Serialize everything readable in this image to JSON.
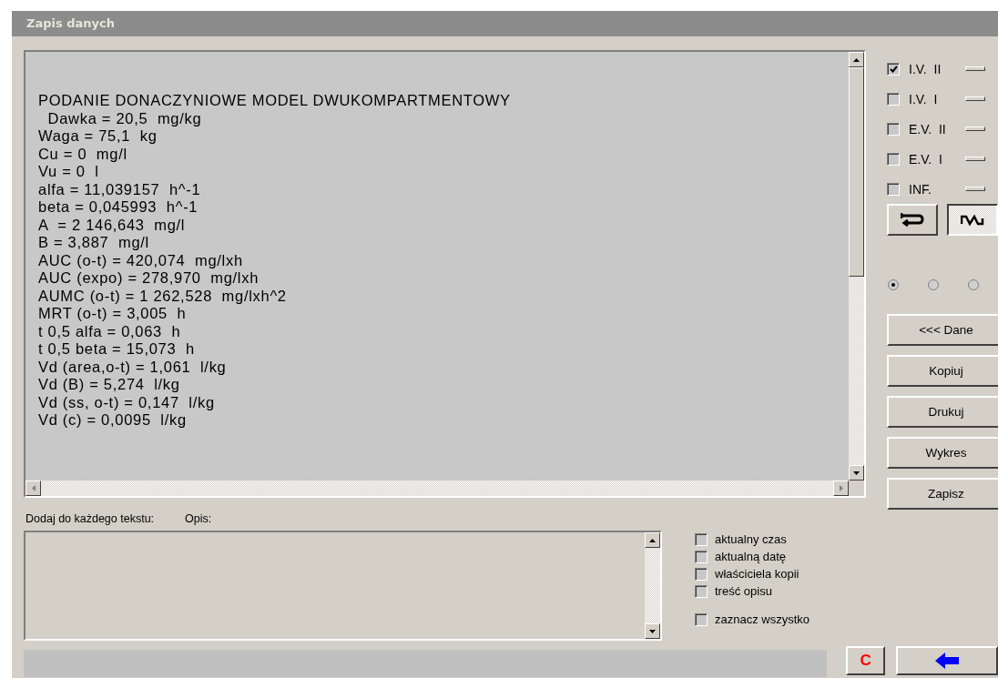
{
  "window": {
    "title": "Zapis danych"
  },
  "output": {
    "lines": [
      "PODANIE DONACZYNIOWE MODEL DWUKOMPARTMENTOWY",
      "  Dawka = 20,5  mg/kg",
      "Waga = 75,1  kg",
      "Cu = 0  mg/l",
      "Vu = 0  l",
      "alfa = 11,039157  h^-1",
      "beta = 0,045993  h^-1",
      "A  = 2 146,643  mg/l",
      "B = 3,887  mg/l",
      "AUC (o-t) = 420,074  mg/lxh",
      "AUC (expo) = 278,970  mg/lxh",
      "AUMC (o-t) = 1 262,528  mg/lxh^2",
      "MRT (o-t) = 3,005  h",
      "t 0,5 alfa = 0,063  h",
      "t 0,5 beta = 15,073  h",
      "Vd (area,o-t) = 1,061  l/kg",
      "Vd (B) = 5,274  l/kg",
      "Vd (ss, o-t) = 0,147  l/kg",
      "Vd (c) = 0,0095  l/kg"
    ]
  },
  "models": [
    {
      "label": "I.V.  II",
      "checked": true
    },
    {
      "label": "I.V.  I",
      "checked": false
    },
    {
      "label": "E.V.  II",
      "checked": false
    },
    {
      "label": "E.V.  I",
      "checked": false
    },
    {
      "label": "INF.",
      "checked": false
    }
  ],
  "mode_buttons": [
    {
      "kind": "loop",
      "selected": false
    },
    {
      "kind": "wave",
      "selected": true
    }
  ],
  "radios": [
    {
      "selected": true
    },
    {
      "selected": false
    },
    {
      "selected": false
    }
  ],
  "actions": [
    "<<<  Dane",
    "Kopiuj",
    "Drukuj",
    "Wykres",
    "Zapisz"
  ],
  "description": {
    "label_1": "Dodaj do każdego  tekstu:",
    "label_2": "Opis:"
  },
  "options": [
    {
      "label": "aktualny czas",
      "checked": false
    },
    {
      "label": "aktualną datę",
      "checked": false
    },
    {
      "label": "właściciela kopii",
      "checked": false
    },
    {
      "label": "treść opisu",
      "checked": false
    },
    {
      "label": "zaznacz wszystko",
      "checked": false
    }
  ],
  "bottom": {
    "clear_label": "C"
  }
}
